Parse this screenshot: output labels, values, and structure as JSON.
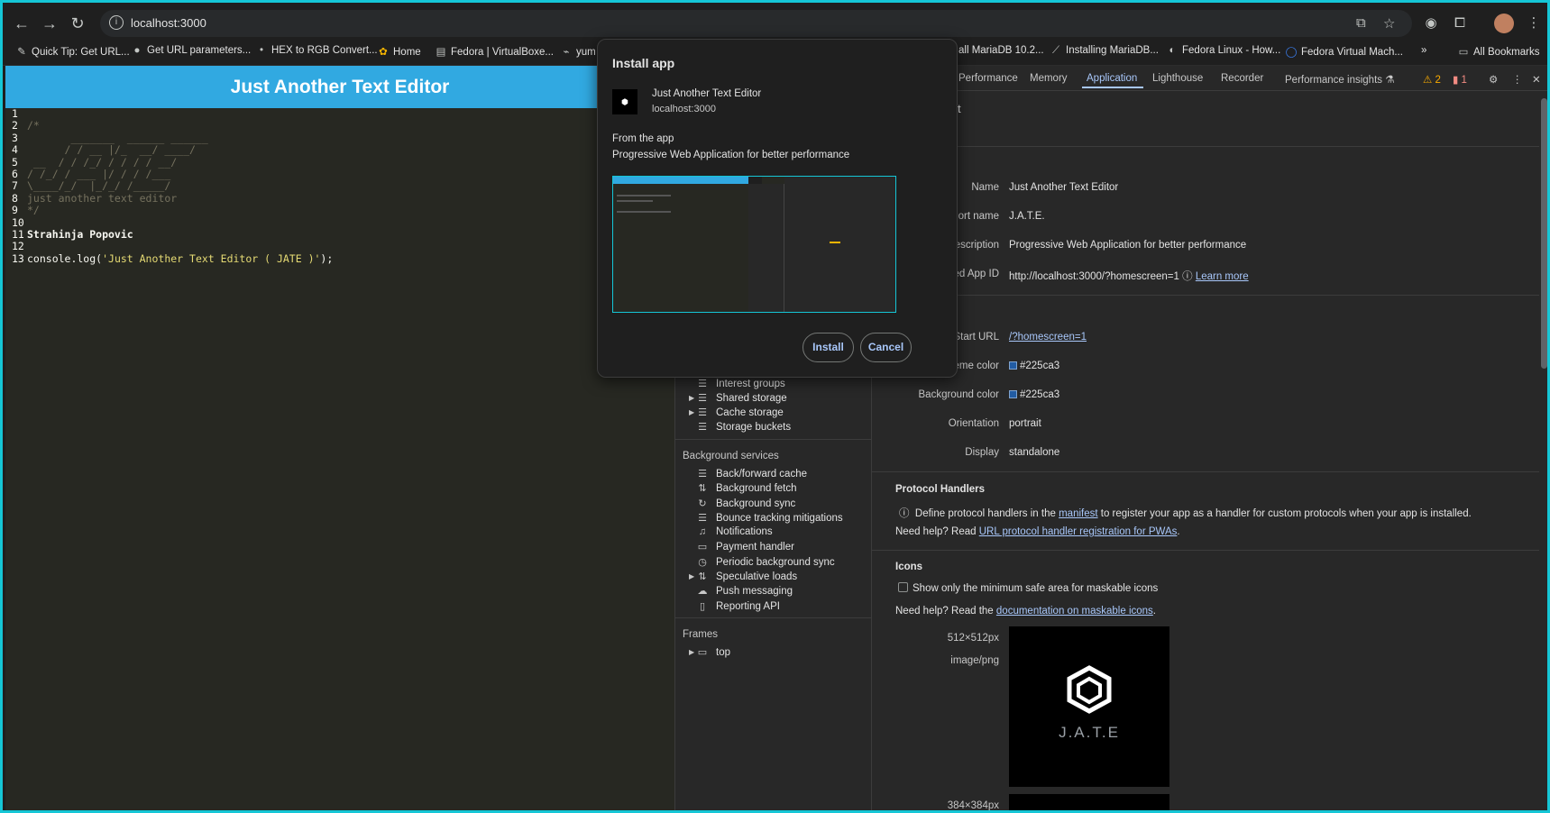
{
  "browser": {
    "url": "localhost:3000",
    "bookmarks": [
      "Quick Tip: Get URL...",
      "Get URL parameters...",
      "HEX to RGB Convert...",
      "Home",
      "Fedora | VirtualBoxe...",
      "yum",
      "all MariaDB 10.2...",
      "Installing MariaDB...",
      "Fedora Linux - How...",
      "Fedora Virtual Mach..."
    ],
    "all_bookmarks": "All Bookmarks"
  },
  "app": {
    "header_title": "Just Another Text Editor",
    "lines": [
      {
        "n": "1",
        "t": ""
      },
      {
        "n": "2",
        "t": "/*"
      },
      {
        "n": "3",
        "t": "       _______  ______ ______"
      },
      {
        "n": "4",
        "t": "      / / __ |/_  __/ ____/"
      },
      {
        "n": "5",
        "t": " __  / / /_/ / / / / __/"
      },
      {
        "n": "6",
        "t": "/ /_/ / ___ |/ / / /___"
      },
      {
        "n": "7",
        "t": "\\____/_/  |_/_/ /_____/"
      },
      {
        "n": "8",
        "t": "just another text editor"
      },
      {
        "n": "9",
        "t": "*/"
      },
      {
        "n": "10",
        "t": ""
      },
      {
        "n": "11",
        "t": "Strahinja Popovic"
      },
      {
        "n": "12",
        "t": ""
      },
      {
        "n": "13",
        "t": "console.log('Just Another Text Editor ( JATE )');"
      }
    ]
  },
  "devtools": {
    "tabs": [
      "Performance",
      "Memory",
      "Application",
      "Lighthouse",
      "Recorder",
      "Performance insights"
    ],
    "active_tab": "Application",
    "warnings": "2",
    "errors": "1",
    "sidebar": {
      "storage_items": [
        "Interest groups",
        "Shared storage",
        "Cache storage",
        "Storage buckets"
      ],
      "background_header": "Background services",
      "background_items": [
        "Back/forward cache",
        "Background fetch",
        "Background sync",
        "Bounce tracking mitigations",
        "Notifications",
        "Payment handler",
        "Periodic background sync",
        "Speculative loads",
        "Push messaging",
        "Reporting API"
      ],
      "frames_header": "Frames",
      "frames_item": "top"
    },
    "manifest": {
      "section_title_fragment": "t",
      "name_label": "Name",
      "name": "Just Another Text Editor",
      "short_name_label": "hort name",
      "short_name": "J.A.T.E.",
      "description_label": "escription",
      "description": "Progressive Web Application for better performance",
      "app_id_label": "ed App ID",
      "app_id": "http://localhost:3000/?homescreen=1",
      "learn_more": "Learn more",
      "start_url_label": "Start URL",
      "start_url": "/?homescreen=1",
      "theme_color_label": "eme color",
      "theme_color": "#225ca3",
      "bg_color_label": "Background color",
      "bg_color": "#225ca3",
      "orientation_label": "Orientation",
      "orientation": "portrait",
      "display_label": "Display",
      "display": "standalone",
      "protocol_title": "Protocol Handlers",
      "protocol_text_1": "Define protocol handlers in the",
      "protocol_link": "manifest",
      "protocol_text_2": "to register your app as a handler for custom protocols when your app is installed.",
      "protocol_help": "Need help? Read",
      "protocol_help_link": "URL protocol handler registration for PWAs",
      "icons_title": "Icons",
      "icons_checkbox": "Show only the minimum safe area for maskable icons",
      "icons_help": "Need help? Read the",
      "icons_help_link": "documentation on maskable icons",
      "icon_size": "512×512px",
      "icon_type": "image/png",
      "icon_text": "J.A.T.E",
      "icon_size_2": "384×384px"
    }
  },
  "dialog": {
    "title": "Install app",
    "app_name": "Just Another Text Editor",
    "host": "localhost:3000",
    "from_app": "From the app",
    "description": "Progressive Web Application for better performance",
    "install": "Install",
    "cancel": "Cancel"
  }
}
